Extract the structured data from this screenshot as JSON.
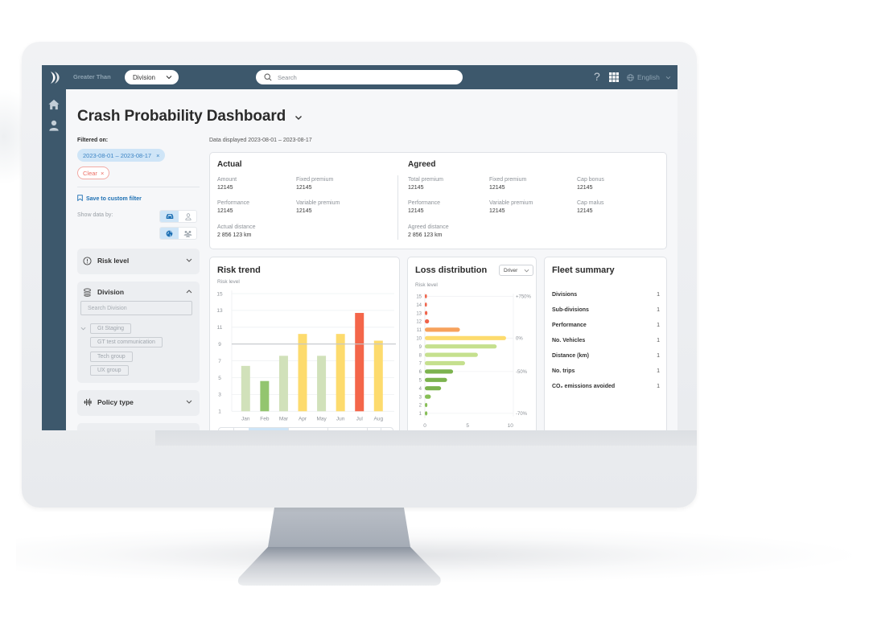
{
  "navbar": {
    "brand": "Greater Than",
    "division_select": {
      "selected": "Division"
    },
    "search": {
      "placeholder": "Search"
    },
    "help_label": "?",
    "language": "English"
  },
  "sidebar_nav": {
    "items": [
      {
        "icon": "home-icon"
      },
      {
        "icon": "person-icon"
      }
    ]
  },
  "page": {
    "title": "Crash Probability Dashboard",
    "data_displayed": "Data displayed 2023-08-01 – 2023-08-17"
  },
  "filters": {
    "filtered_on_label": "Filtered on:",
    "active_chips": [
      "2023-08-01 – 2023-08-17"
    ],
    "chip_close": "×",
    "clear_label": "Clear",
    "save_custom_filter_label": "Save to custom filter",
    "show_data_by_label": "Show data by:",
    "show_data_by": {
      "row1": {
        "options": [
          "vehicle",
          "driver"
        ],
        "selected": "vehicle"
      },
      "row2": {
        "options": [
          "global",
          "group"
        ],
        "selected": "global"
      }
    },
    "panels": [
      {
        "title": "Risk level",
        "icon": "info-circle-icon",
        "expanded": false
      },
      {
        "title": "Division",
        "icon": "layers-icon",
        "expanded": true,
        "search_placeholder": "Search Division",
        "tree": [
          "Gt Staging",
          "GT test communication",
          "Tech group",
          "UX group"
        ]
      },
      {
        "title": "Policy type",
        "icon": "policy-icon",
        "expanded": false
      }
    ]
  },
  "summary": {
    "actual": {
      "title": "Actual",
      "fields": [
        {
          "label": "Amount",
          "value": "12145"
        },
        {
          "label": "Fixed premium",
          "value": "12145"
        },
        {
          "label": "Performance",
          "value": "12145"
        },
        {
          "label": "Variable premium",
          "value": "12145"
        },
        {
          "label": "Actual distance",
          "value": "2 856 123 km"
        }
      ]
    },
    "agreed": {
      "title": "Agreed",
      "fields": [
        {
          "label": "Total premium",
          "value": "12145"
        },
        {
          "label": "Fixed premium",
          "value": "12145"
        },
        {
          "label": "Cap bonus",
          "value": "12145"
        },
        {
          "label": "Performance",
          "value": "12145"
        },
        {
          "label": "Variable premium",
          "value": "12145"
        },
        {
          "label": "Cap malus",
          "value": "12145"
        },
        {
          "label": "Agreed distance",
          "value": "2 856 123 km"
        }
      ]
    }
  },
  "risk_trend": {
    "title": "Risk trend",
    "ylabel": "Risk level",
    "period_selector_active_index": 2
  },
  "loss_distribution": {
    "title": "Loss distribution",
    "ylabel": "Risk level",
    "dropdown": "Driver"
  },
  "fleet_summary": {
    "title": "Fleet summary",
    "rows": [
      {
        "label": "Divisions",
        "value": "1"
      },
      {
        "label": "Sub-divisions",
        "value": "1"
      },
      {
        "label": "Performance",
        "value": "1"
      },
      {
        "label": "No. Vehicles",
        "value": "1"
      },
      {
        "label": "Distance (km)",
        "value": "1"
      },
      {
        "label": "No. trips",
        "value": "1"
      },
      {
        "label": "CO₂ emissions avoided",
        "value": "1"
      }
    ]
  },
  "colors": {
    "navbar": "#3d586c",
    "accent_blue": "#1c6fb3",
    "chip_bg": "#cfe5f7",
    "clear_red": "#ec6c62",
    "risk_red": "#f4664a",
    "risk_orange": "#f7a25c",
    "risk_yellow": "#fddb6d",
    "risk_light_green": "#d1e1ba",
    "risk_green": "#93c56f"
  },
  "chart_data": [
    {
      "type": "bar",
      "title": "Risk trend",
      "xlabel": "",
      "ylabel": "Risk level",
      "categories": [
        "Jan",
        "Feb",
        "Mar",
        "Apr",
        "May",
        "Jun",
        "Jul",
        "Aug"
      ],
      "values": [
        6.4,
        4.6,
        7.6,
        10.2,
        7.6,
        10.2,
        12.7,
        9.4
      ],
      "bar_colors": [
        "#d1e1ba",
        "#93c56f",
        "#d1e1ba",
        "#fddb6d",
        "#d1e1ba",
        "#fddb6d",
        "#f4664a",
        "#fddb6d"
      ],
      "yticks": [
        1,
        3,
        5,
        7,
        9,
        11,
        13,
        15
      ],
      "ylim": [
        1,
        15
      ],
      "reference_line": 9,
      "grid": true
    },
    {
      "type": "bar",
      "orientation": "horizontal",
      "title": "Loss distribution",
      "ylabel": "Risk level",
      "categories": [
        15,
        14,
        13,
        12,
        11,
        10,
        9,
        8,
        7,
        6,
        5,
        4,
        3,
        2,
        1
      ],
      "values": [
        0.15,
        0.15,
        0.3,
        0.5,
        4.1,
        9.5,
        8.4,
        6.2,
        4.7,
        3.3,
        2.6,
        1.9,
        0.7,
        0.3,
        0.3
      ],
      "bar_colors": [
        "#f0634a",
        "#f0634a",
        "#f0634a",
        "#f0634a",
        "#f7a25c",
        "#fddb6d",
        "#c5e08e",
        "#c5e08e",
        "#c5e08e",
        "#7cb34e",
        "#7cb34e",
        "#7cb34e",
        "#86be55",
        "#86be55",
        "#86be55"
      ],
      "xticks": [
        0,
        5,
        10
      ],
      "xlim": [
        0,
        10
      ],
      "right_annotations": [
        {
          "category": 15,
          "label": "+750%"
        },
        {
          "category": 10,
          "label": "0%"
        },
        {
          "category": 6,
          "label": "-50%"
        },
        {
          "category": 1,
          "label": "-70%"
        }
      ]
    }
  ]
}
